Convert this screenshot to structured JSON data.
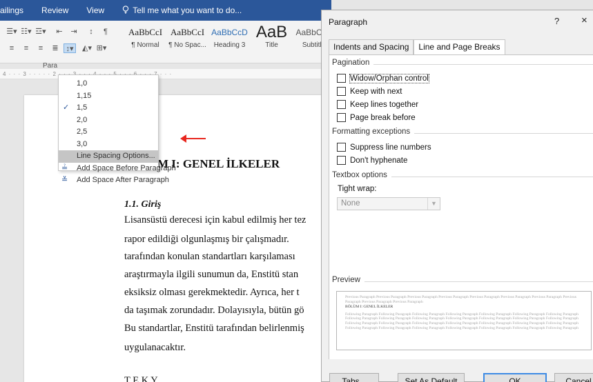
{
  "ribbon": {
    "tabs": [
      "ailings",
      "Review",
      "View"
    ],
    "tell_me": "Tell me what you want to do...",
    "paragraph_group": "Para",
    "styles": [
      {
        "sample": "AaBbCcI",
        "name": "¶ Normal"
      },
      {
        "sample": "AaBbCcI",
        "name": "¶ No Spac..."
      },
      {
        "sample": "AaBbCcD",
        "name": "Heading 3"
      },
      {
        "sample": "AaB",
        "name": "Title"
      },
      {
        "sample": "AaBbCcE",
        "name": "Subtitle"
      }
    ],
    "ruler_text": "4 · · · 3 · ·                        · · · 2 · · · 3 · · · 4 · · · 5 · · · 6 · · · 7 · · ·"
  },
  "line_spacing_menu": {
    "items": [
      "1,0",
      "1,15",
      "1,5",
      "2,0",
      "2,5",
      "3,0"
    ],
    "checked": "1,5",
    "options": "Line Spacing Options...",
    "add_before": "Add Space Before Paragraph",
    "add_after": "Add Space After Paragraph"
  },
  "document": {
    "heading": "M I: GENEL İLKELER",
    "subheading": "1.1. Giriş",
    "lines": [
      "Lisansüstü derecesi için kabul edilmiş her tez",
      "rapor edildiği olgunlaşmış bir çalışmadır.",
      "tarafından konulan standartları karşılaması",
      "araştırmayla ilgili sunumun da, Enstitü stan",
      "eksiksiz olması gerekmektedir. Ayrıca, her t",
      "da taşımak zorundadır. Dolayısıyla, bütün gö",
      "Bu standartlar, Enstitü tarafından belirlenmiş",
      "uygulanacaktır.",
      "T                    E    K    Y"
    ]
  },
  "dialog": {
    "title": "Paragraph",
    "help": "?",
    "close": "×",
    "tab_indents": "Indents and Spacing",
    "tab_breaks": "Line and Page Breaks",
    "pagination": "Pagination",
    "widow": "Widow/Orphan control",
    "keep_next": "Keep with next",
    "keep_lines": "Keep lines together",
    "page_break": "Page break before",
    "formatting": "Formatting exceptions",
    "suppress": "Suppress line numbers",
    "dont_hyphenate": "Don't hyphenate",
    "textbox": "Textbox options",
    "tight_wrap_label": "Tight wrap:",
    "tight_wrap_value": "None",
    "preview": "Preview",
    "preview_prev": "Previous Paragraph Previous Paragraph Previous Paragraph Previous Paragraph Previous Paragraph Previous Paragraph Previous Paragraph Previous Paragraph Previous Paragraph Previous Paragraph",
    "preview_main": "BÖLÜM I: GENEL İLKELER",
    "preview_follow": "Following Paragraph Following Paragraph Following Paragraph Following Paragraph Following Paragraph Following Paragraph Following Paragraph Following Paragraph Following Paragraph Following Paragraph Following Paragraph Following Paragraph Following Paragraph Following Paragraph Following Paragraph Following Paragraph Following Paragraph Following Paragraph Following Paragraph Following Paragraph Following Paragraph Following Paragraph Following Paragraph Following Paragraph Following Paragraph Following Paragraph Following Paragraph Following Paragraph",
    "btn_tabs": "Tabs...",
    "btn_default": "Set As Default",
    "btn_ok": "OK",
    "btn_cancel": "Cancel"
  }
}
